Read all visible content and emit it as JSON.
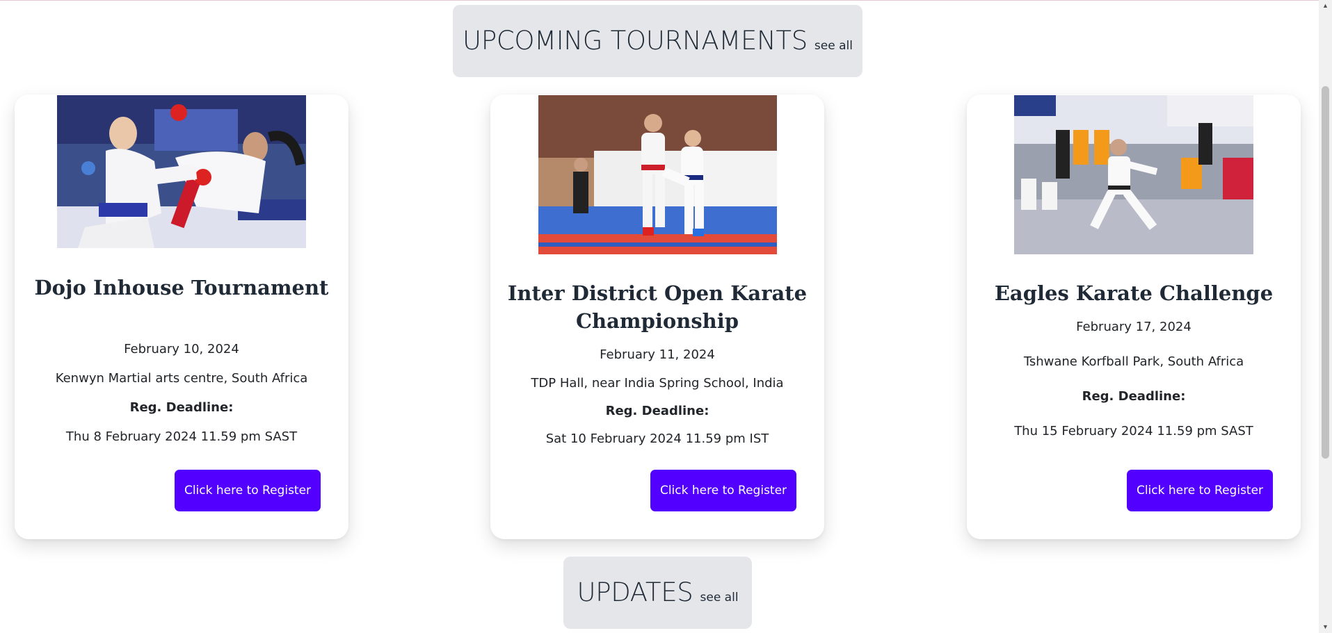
{
  "sections": {
    "upcoming": {
      "title": "UPCOMING TOURNAMENTS",
      "see_all": "see all"
    },
    "updates": {
      "title": "UPDATES",
      "see_all": "see all"
    }
  },
  "tournaments": [
    {
      "title": "Dojo Inhouse Tournament",
      "date": "February 10, 2024",
      "location": "Kenwyn Martial arts centre, South Africa",
      "deadline_label": "Reg. Deadline:",
      "deadline": "Thu 8 February 2024 11.59 pm SAST",
      "button_label": "Click here to Register",
      "image": "kumite-sparring-photo"
    },
    {
      "title": "Inter District Open Karate Championship",
      "date": "February 11, 2024",
      "location": "TDP Hall, near India Spring School, India",
      "deadline_label": "Reg. Deadline:",
      "deadline": "Sat 10 February 2024 11.59 pm IST",
      "button_label": "Click here to Register",
      "image": "karate-kick-match-photo"
    },
    {
      "title": "Eagles Karate Challenge",
      "date": "February 17, 2024",
      "location": "Tshwane Korfball Park, South Africa",
      "deadline_label": "Reg. Deadline:",
      "deadline": "Thu 15 February 2024 11.59 pm SAST",
      "button_label": "Click here to Register",
      "image": "kata-demonstration-photo"
    }
  ],
  "colors": {
    "accent": "#5200ff",
    "header_bg": "#e5e6ea",
    "text": "#1f2a36"
  }
}
